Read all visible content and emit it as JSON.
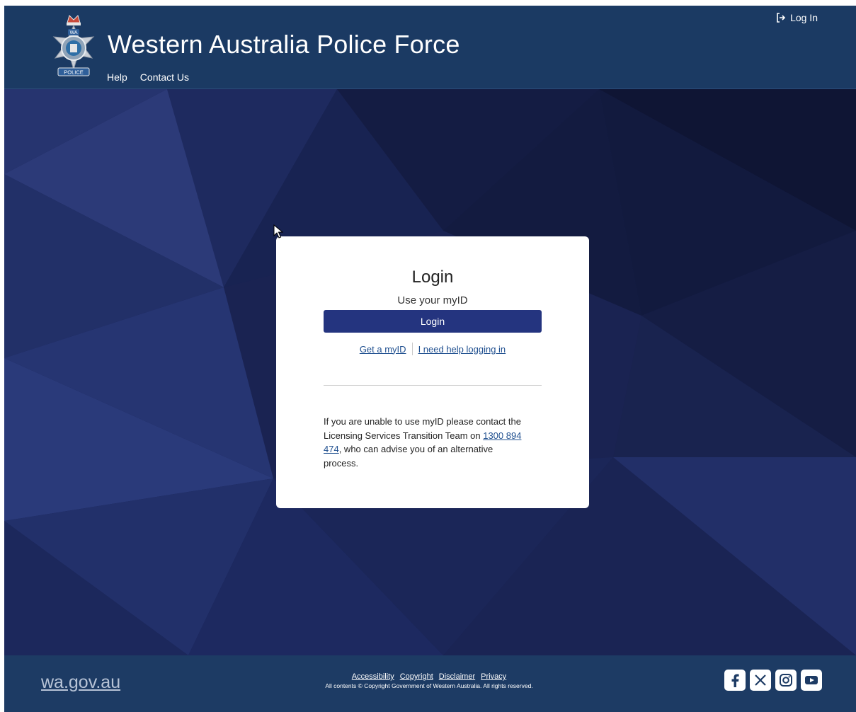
{
  "header": {
    "site_title": "Western Australia Police Force",
    "crest_label_top": "WA",
    "crest_label_bottom": "POLICE",
    "nav": [
      "Help",
      "Contact Us"
    ],
    "login_label": "Log In"
  },
  "card": {
    "title": "Login",
    "subtitle": "Use your myID",
    "button_label": "Login",
    "link_get_myid": "Get a myID",
    "link_help": "I need help logging in",
    "info_text_1": "If you are unable to use myID please contact the Licensing Services Transition Team on ",
    "info_phone": "1300 894 474",
    "info_text_2": ", who can advise you of an alternative process."
  },
  "footer": {
    "wagov": "wa.gov.au",
    "links": [
      "Accessibility",
      "Copyright",
      "Disclaimer",
      "Privacy"
    ],
    "copyright": "All contents © Copyright Government of Western Australia. All rights reserved.",
    "social": [
      "facebook-icon",
      "x-icon",
      "instagram-icon",
      "youtube-icon"
    ]
  },
  "colors": {
    "header_bg": "#1b3a63",
    "hero_bg": "#17204a",
    "button_bg": "#24347f",
    "link": "#1f4f8f",
    "footer_bg": "#1d3b64"
  }
}
